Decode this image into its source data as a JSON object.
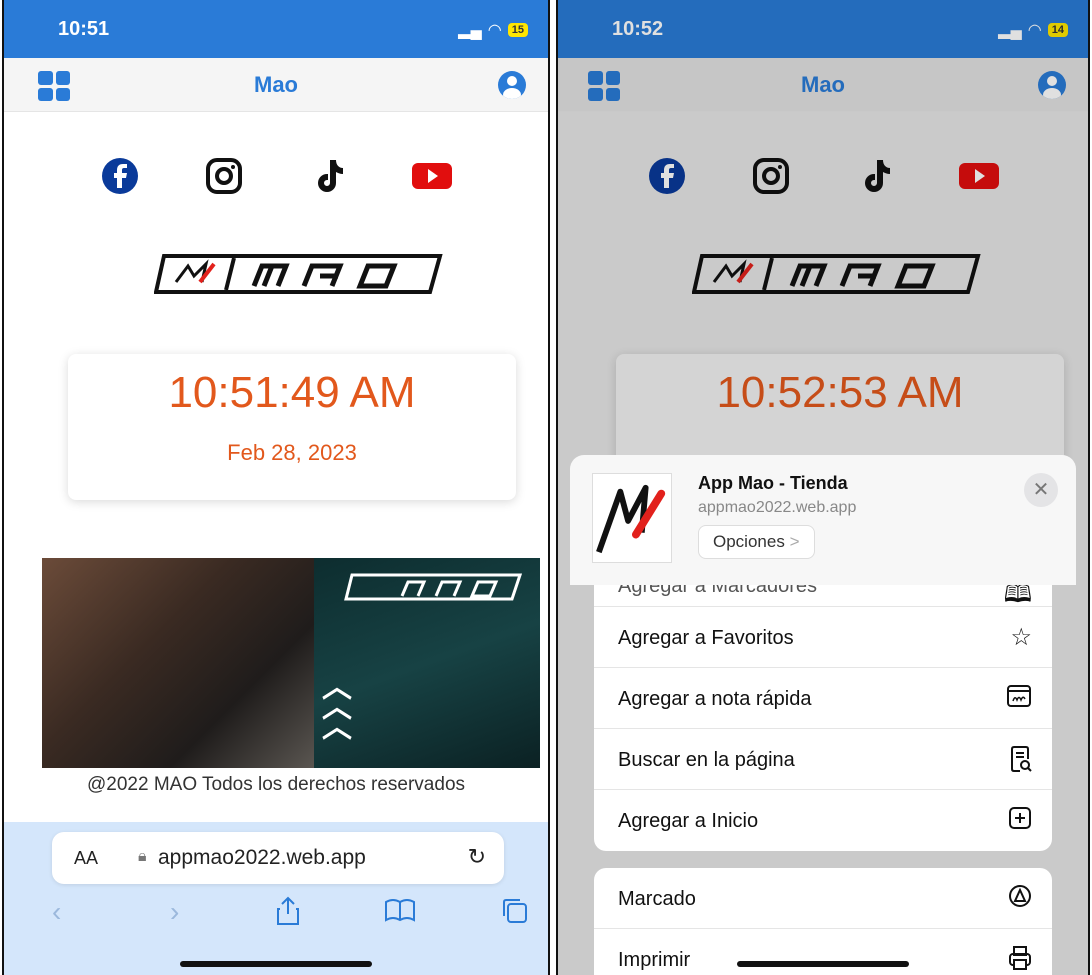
{
  "phone1": {
    "status_time": "10:51",
    "battery": "15",
    "nav_title": "Mao",
    "clock_time": "10:51:49 AM",
    "clock_date": "Feb 28, 2023",
    "footer": "@2022 MAO Todos los derechos reservados",
    "url": "appmao2022.web.app",
    "aa": "AA"
  },
  "phone2": {
    "status_time": "10:52",
    "battery": "14",
    "nav_title": "Mao",
    "clock_time": "10:52:53 AM",
    "sheet": {
      "app_title": "App Mao - Tienda",
      "app_url": "appmao2022.web.app",
      "options": "Opciones"
    },
    "menu_group1": [
      {
        "label": "Agregar a Marcadores",
        "icon": "book-icon"
      },
      {
        "label": "Agregar a Favoritos",
        "icon": "star-icon"
      },
      {
        "label": "Agregar a nota rápida",
        "icon": "quick-note-icon"
      },
      {
        "label": "Buscar en la página",
        "icon": "find-in-page-icon"
      },
      {
        "label": "Agregar a Inicio",
        "icon": "add-square-icon"
      }
    ],
    "menu_group2": [
      {
        "label": "Marcado",
        "icon": "markup-icon"
      },
      {
        "label": "Imprimir",
        "icon": "print-icon"
      }
    ]
  },
  "colors": {
    "accent": "#2a7bd7",
    "clock": "#e2581c",
    "safari_bar": "#d4e6fb"
  }
}
